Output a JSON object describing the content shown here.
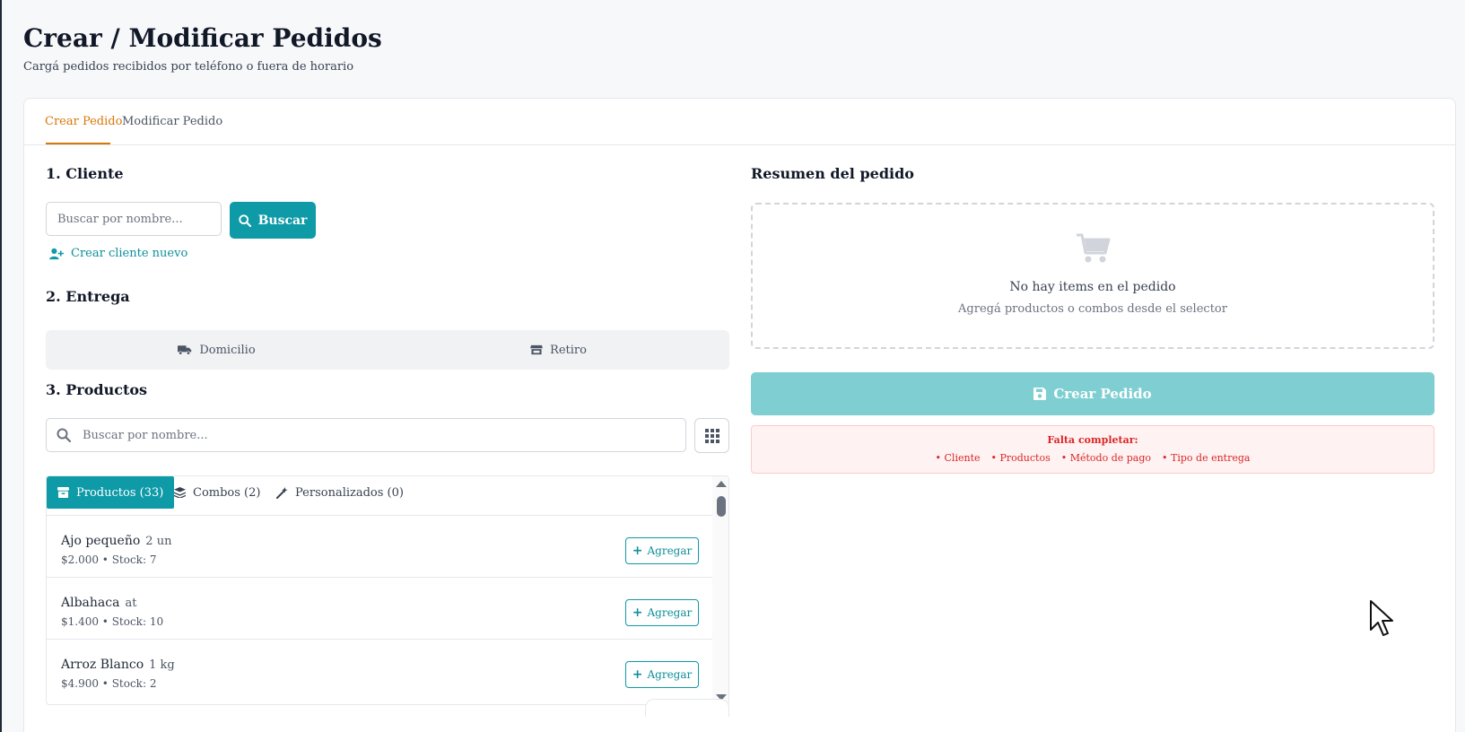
{
  "page": {
    "title": "Crear / Modificar Pedidos",
    "subtitle": "Cargá pedidos recibidos por teléfono o fuera de horario"
  },
  "tabs": [
    {
      "label": "Crear Pedido",
      "active": true
    },
    {
      "label": "Modificar Pedido",
      "active": false
    }
  ],
  "cliente": {
    "title": "1. Cliente",
    "search_placeholder": "Buscar por nombre...",
    "search_button": "Buscar",
    "create_link": "Crear cliente nuevo"
  },
  "entrega": {
    "title": "2. Entrega",
    "options": [
      {
        "label": "Domicilio",
        "icon": "truck-icon"
      },
      {
        "label": "Retiro",
        "icon": "store-icon"
      }
    ]
  },
  "productos": {
    "title": "3. Productos",
    "search_placeholder": "Buscar por nombre...",
    "tabs": [
      {
        "label": "Productos (33)",
        "icon": "box-icon",
        "active": true
      },
      {
        "label": "Combos (2)",
        "icon": "layers-icon",
        "active": false
      },
      {
        "label": "Personalizados (0)",
        "icon": "wand-icon",
        "active": false
      }
    ],
    "items": [
      {
        "name": "Ajo pequeño",
        "unit": "2 un",
        "meta": "$2.000 • Stock: 7",
        "action": "Agregar"
      },
      {
        "name": "Albahaca",
        "unit": "at",
        "meta": "$1.400 • Stock: 10",
        "action": "Agregar"
      },
      {
        "name": "Arroz Blanco",
        "unit": "1 kg",
        "meta": "$4.900 • Stock: 2",
        "action": "Agregar"
      }
    ]
  },
  "resumen": {
    "title": "Resumen del pedido",
    "empty_title": "No hay items en el pedido",
    "empty_subtitle": "Agregá productos o combos desde el selector",
    "create_button": "Crear Pedido",
    "missing_title": "Falta completar:",
    "missing_items": [
      "• Cliente",
      "• Productos",
      "• Método de pago",
      "• Tipo de entrega"
    ]
  },
  "colors": {
    "primary": "#0e9aa7",
    "primary_disabled": "#7fcfd2",
    "tab_active": "#d97706",
    "error": "#dc2626"
  }
}
